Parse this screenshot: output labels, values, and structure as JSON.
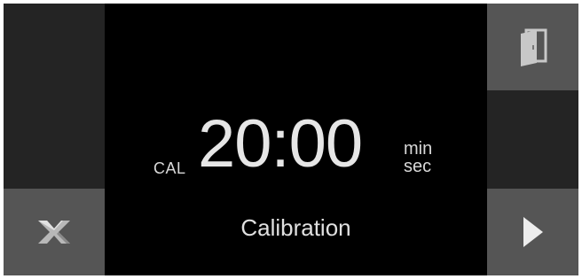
{
  "buttons": {
    "cancel_icon": "close-icon",
    "door_icon": "door-icon",
    "start_icon": "play-icon"
  },
  "display": {
    "prefix": "CAL",
    "time": "20:00",
    "unit_top": "min",
    "unit_bottom": "sec",
    "mode": "Calibration"
  },
  "colors": {
    "background": "#000000",
    "button_dark": "#242424",
    "button_light": "#555555",
    "text": "#e6e6e6"
  }
}
